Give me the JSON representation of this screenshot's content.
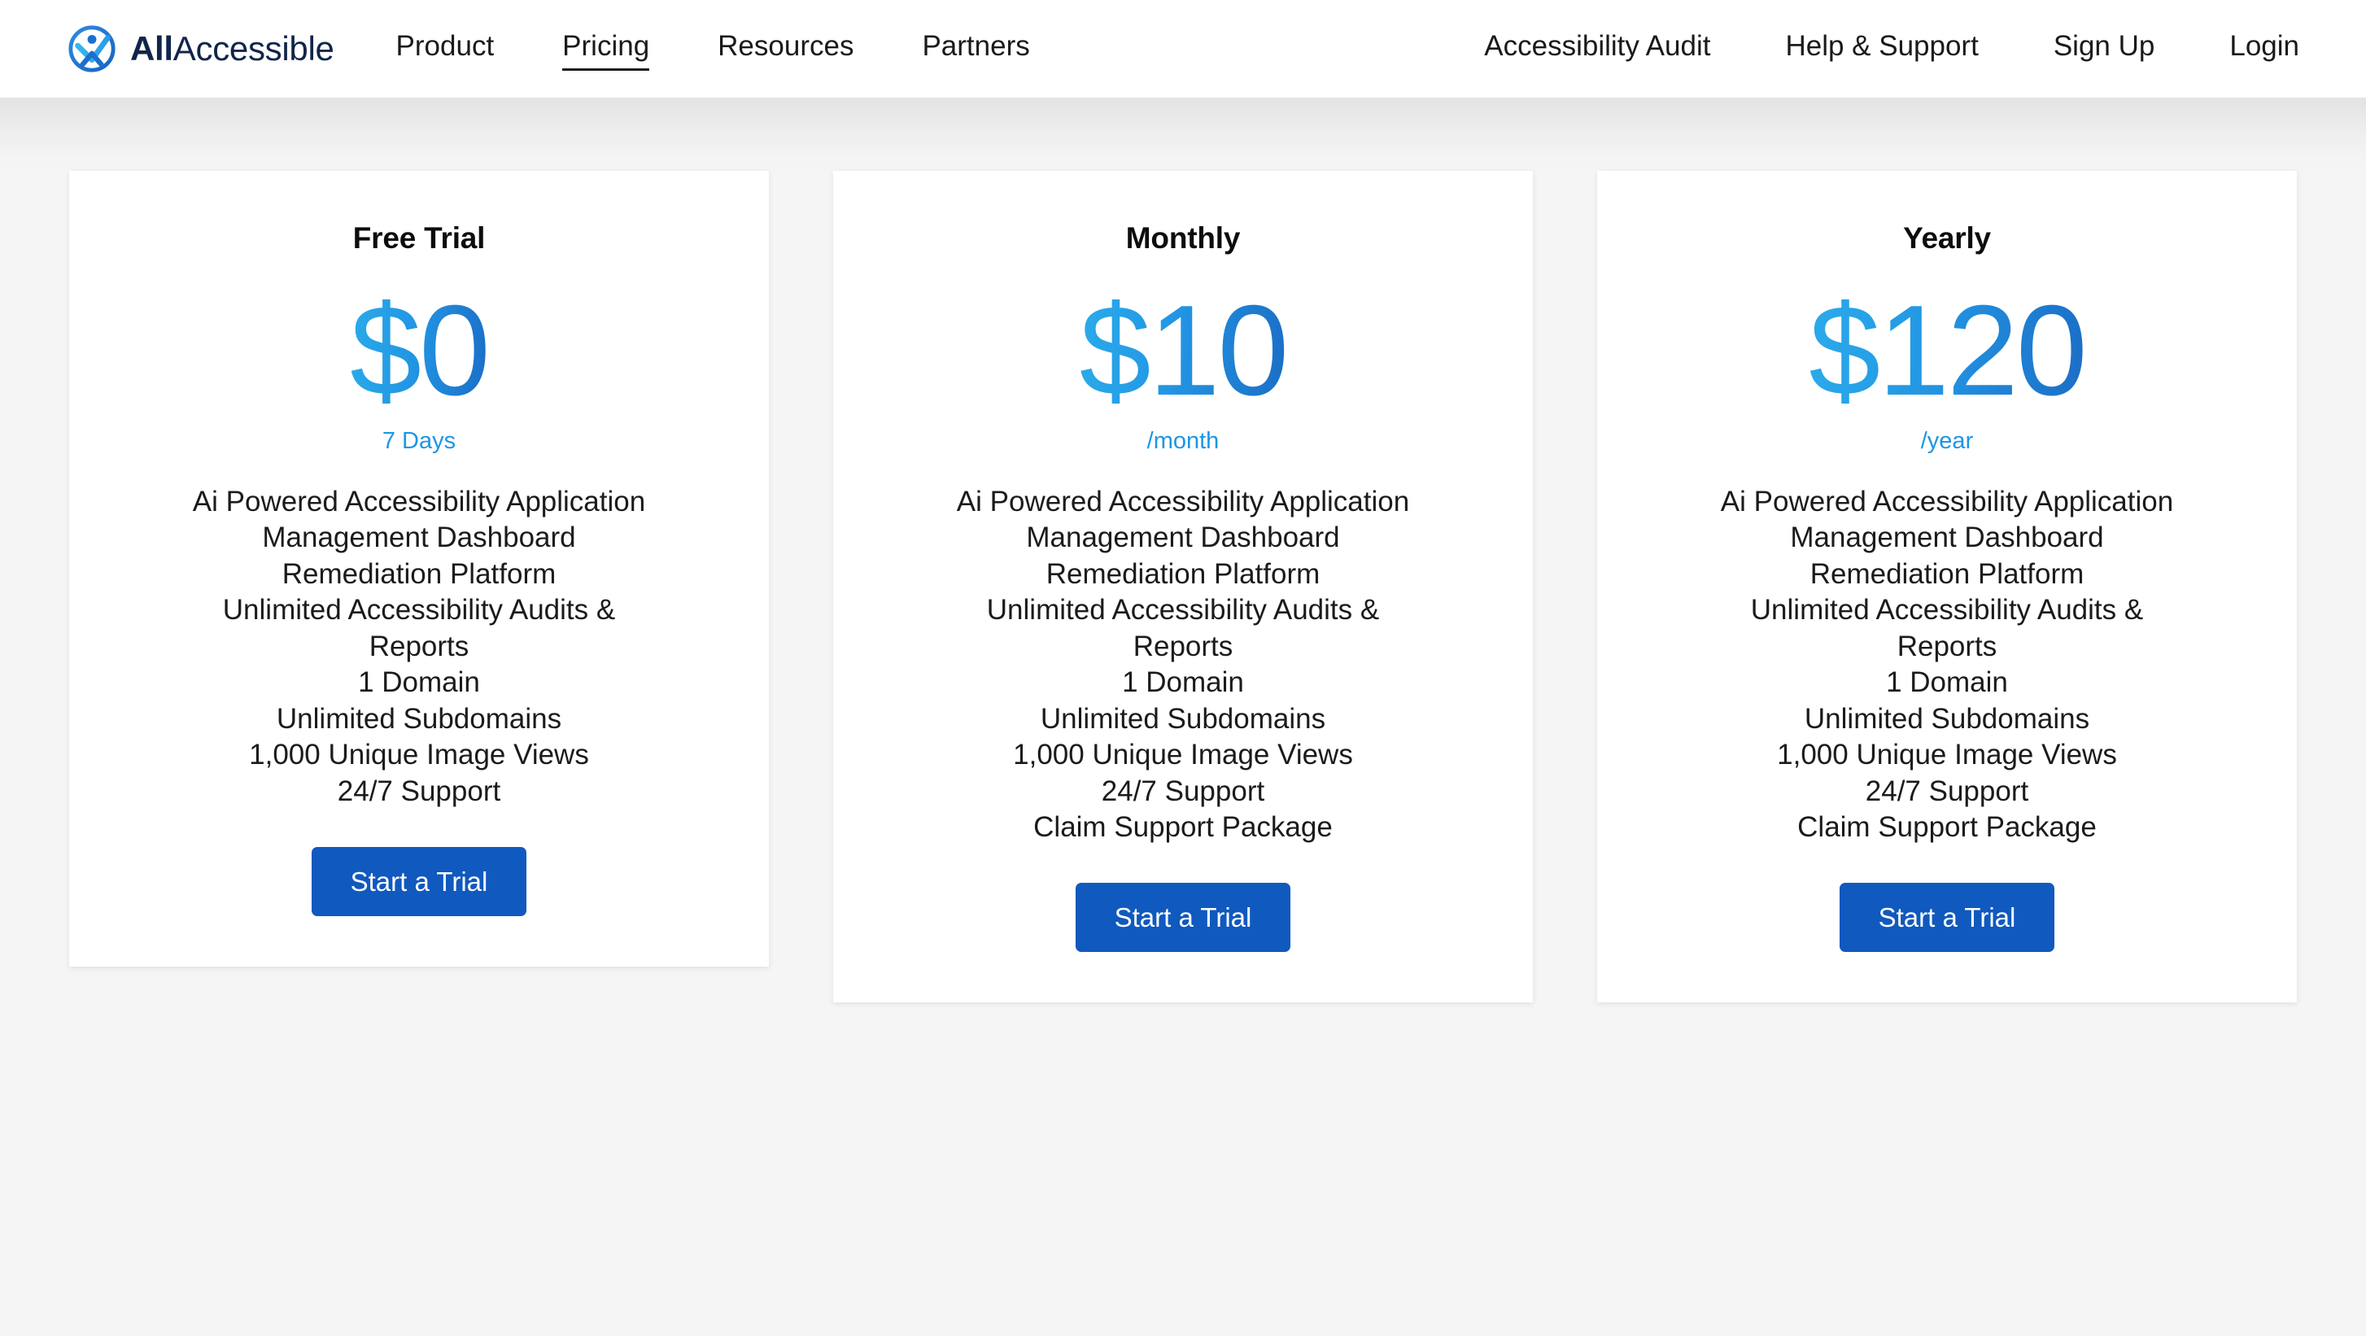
{
  "header": {
    "brand": {
      "logo_icon": "accessibility-check-circle-icon",
      "name_strong": "All",
      "name_light": "Accessible"
    },
    "nav_main": [
      {
        "label": "Product",
        "active": false
      },
      {
        "label": "Pricing",
        "active": true
      },
      {
        "label": "Resources",
        "active": false
      },
      {
        "label": "Partners",
        "active": false
      }
    ],
    "nav_right": [
      {
        "label": "Accessibility Audit"
      },
      {
        "label": "Help & Support"
      },
      {
        "label": "Sign Up"
      },
      {
        "label": "Login"
      }
    ]
  },
  "colors": {
    "page_background": "#f5f5f5",
    "card_background": "#ffffff",
    "price_gradient_start": "#2BABEA",
    "price_gradient_end": "#1B6DC6",
    "period_text": "#1C96E6",
    "cta_background": "#1059BE",
    "cta_text": "#ffffff",
    "brand_text": "#11254a",
    "nav_text": "#1a1a1a"
  },
  "pricing": {
    "cards": [
      {
        "title": "Free Trial",
        "price": "$0",
        "period": "7 Days",
        "features": [
          "Ai Powered Accessibility Application",
          "Management Dashboard",
          "Remediation Platform",
          "Unlimited Accessibility Audits & Reports",
          "1 Domain",
          "Unlimited Subdomains",
          "1,000 Unique Image Views",
          "24/7 Support"
        ],
        "cta_label": "Start a Trial"
      },
      {
        "title": "Monthly",
        "price": "$10",
        "period": "/month",
        "features": [
          "Ai Powered Accessibility Application",
          "Management Dashboard",
          "Remediation Platform",
          "Unlimited Accessibility Audits & Reports",
          "1 Domain",
          "Unlimited Subdomains",
          "1,000 Unique Image Views",
          "24/7 Support",
          "Claim Support Package"
        ],
        "cta_label": "Start a Trial"
      },
      {
        "title": "Yearly",
        "price": "$120",
        "period": "/year",
        "features": [
          "Ai Powered Accessibility Application",
          "Management Dashboard",
          "Remediation Platform",
          "Unlimited Accessibility Audits & Reports",
          "1 Domain",
          "Unlimited Subdomains",
          "1,000 Unique Image Views",
          "24/7 Support",
          "Claim Support Package"
        ],
        "cta_label": "Start a Trial"
      }
    ]
  }
}
